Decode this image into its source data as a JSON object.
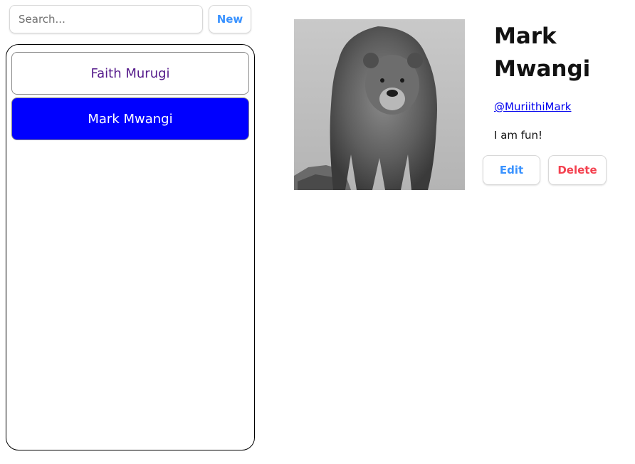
{
  "search": {
    "placeholder": "Search...",
    "value": ""
  },
  "toolbar": {
    "new_label": "New"
  },
  "sidebar": {
    "items": [
      {
        "label": "Faith Murugi",
        "state": "visited"
      },
      {
        "label": "Mark Mwangi",
        "state": "active"
      }
    ]
  },
  "contact": {
    "first_name": "Mark",
    "last_name": "Mwangi",
    "handle": "@MuriithiMark",
    "notes": "I am fun!",
    "avatar_description": "bear-photo"
  },
  "actions": {
    "edit_label": "Edit",
    "delete_label": "Delete"
  },
  "colors": {
    "accent": "#3992ff",
    "danger": "#f44250",
    "active_item": "#0000ff",
    "visited_link": "#551a8b",
    "link": "#0000ee"
  }
}
